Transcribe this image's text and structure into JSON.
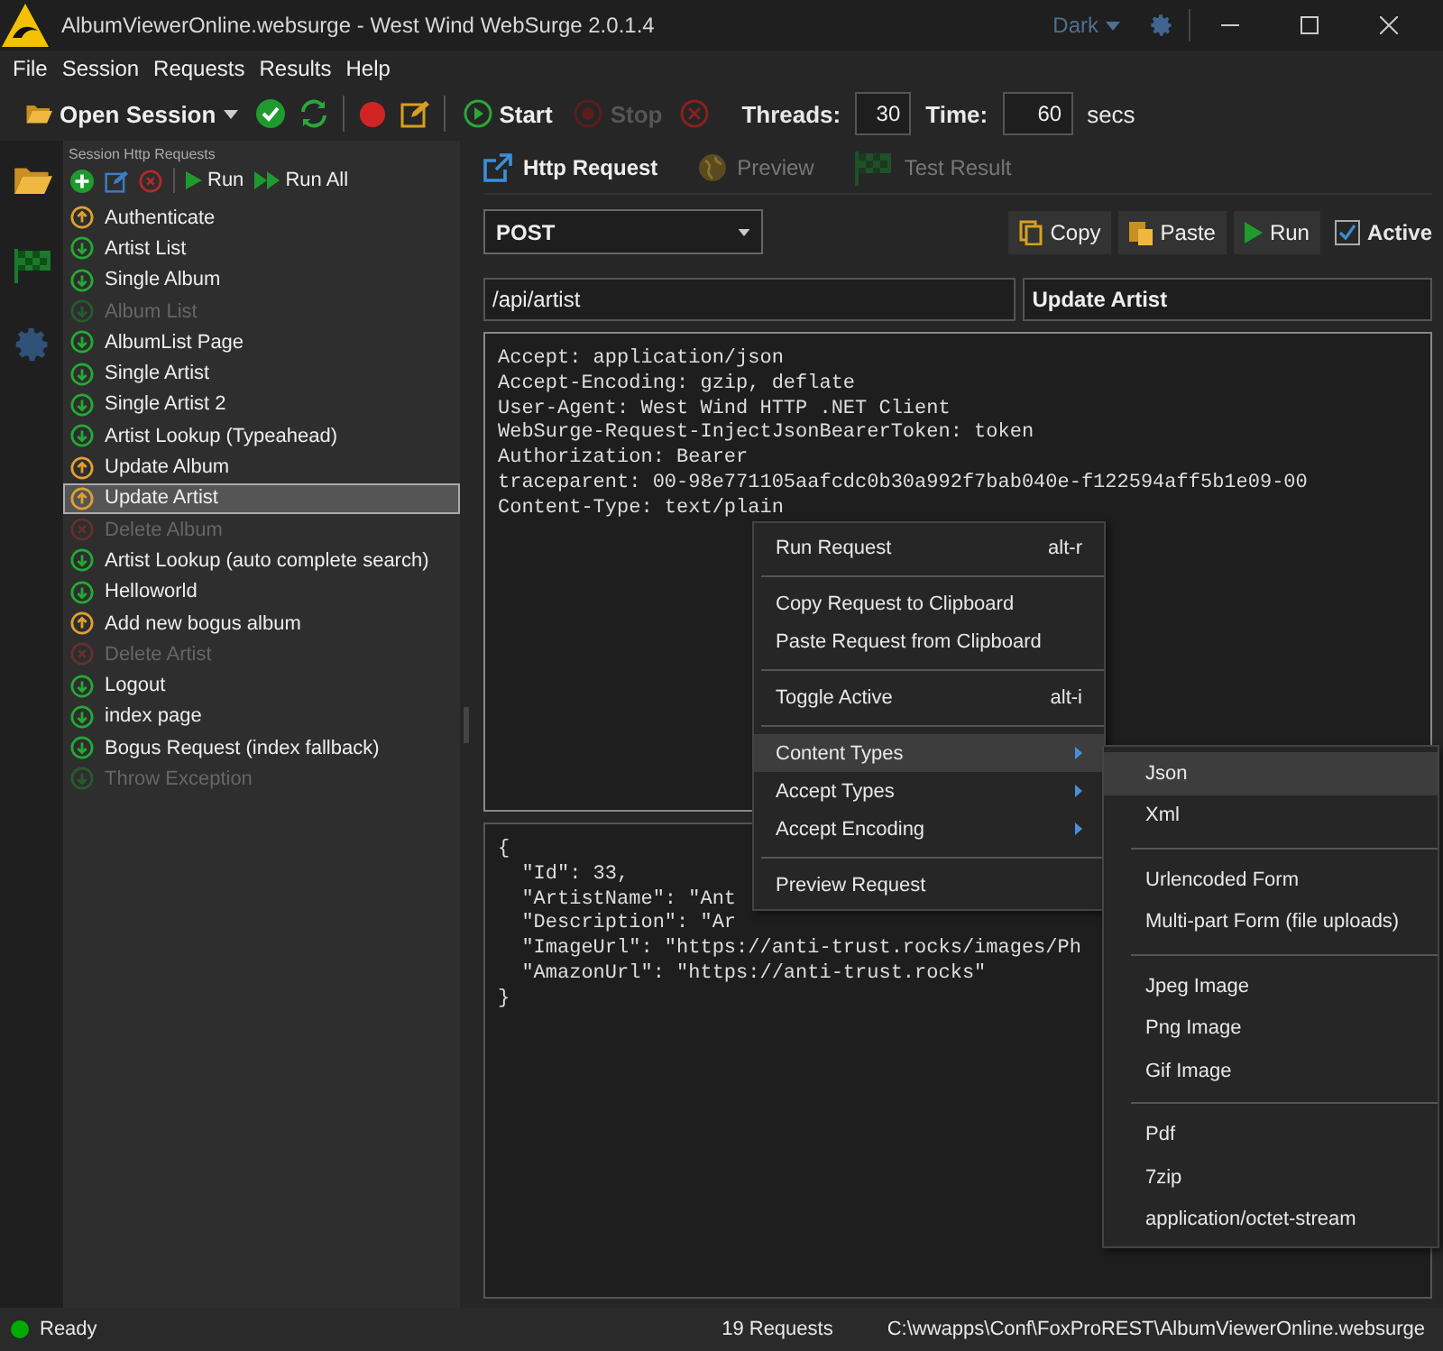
{
  "window": {
    "title": "AlbumViewerOnline.websurge - West Wind WebSurge 2.0.1.4",
    "theme": "Dark"
  },
  "menu_bar": [
    "File",
    "Session",
    "Requests",
    "Results",
    "Help"
  ],
  "toolbar": {
    "open_session": "Open Session",
    "start": "Start",
    "stop": "Stop",
    "threads_label": "Threads:",
    "threads": "30",
    "time_label": "Time:",
    "time": "60",
    "time_unit": "secs"
  },
  "requests_panel": {
    "title": "Session Http Requests",
    "run": "Run",
    "run_all": "Run All",
    "items": [
      {
        "name": "Authenticate",
        "kind": "put",
        "active": true,
        "selected": false
      },
      {
        "name": "Artist List",
        "kind": "get",
        "active": true,
        "selected": false
      },
      {
        "name": "Single Album",
        "kind": "get",
        "active": true,
        "selected": false
      },
      {
        "name": "Album List",
        "kind": "get",
        "active": false,
        "selected": false
      },
      {
        "name": "AlbumList Page",
        "kind": "get",
        "active": true,
        "selected": false
      },
      {
        "name": "Single Artist",
        "kind": "get",
        "active": true,
        "selected": false
      },
      {
        "name": "Single Artist 2",
        "kind": "get",
        "active": true,
        "selected": false
      },
      {
        "name": "Artist Lookup (Typeahead)",
        "kind": "get",
        "active": true,
        "selected": false
      },
      {
        "name": "Update Album",
        "kind": "put",
        "active": true,
        "selected": false
      },
      {
        "name": "Update Artist",
        "kind": "put",
        "active": true,
        "selected": true
      },
      {
        "name": "Delete Album",
        "kind": "delete",
        "active": false,
        "selected": false
      },
      {
        "name": "Artist Lookup (auto complete search)",
        "kind": "get",
        "active": true,
        "selected": false
      },
      {
        "name": "Helloworld",
        "kind": "get",
        "active": true,
        "selected": false
      },
      {
        "name": "Add new bogus album",
        "kind": "put",
        "active": true,
        "selected": false
      },
      {
        "name": "Delete Artist",
        "kind": "delete",
        "active": false,
        "selected": false
      },
      {
        "name": "Logout",
        "kind": "get",
        "active": true,
        "selected": false
      },
      {
        "name": "index page",
        "kind": "get",
        "active": true,
        "selected": false
      },
      {
        "name": "Bogus Request (index fallback)",
        "kind": "get",
        "active": true,
        "selected": false
      },
      {
        "name": "Throw Exception",
        "kind": "get",
        "active": false,
        "selected": false
      }
    ]
  },
  "tabs": [
    {
      "label": "Http Request",
      "selected": true
    },
    {
      "label": "Preview",
      "selected": false
    },
    {
      "label": "Test Result",
      "selected": false
    }
  ],
  "request": {
    "method": "POST",
    "copy": "Copy",
    "paste": "Paste",
    "run": "Run",
    "active": {
      "label": "Active",
      "checked": true
    },
    "url": "/api/artist",
    "name": "Update Artist",
    "headers": [
      "Accept: application/json",
      "Accept-Encoding: gzip, deflate",
      "User-Agent: West Wind HTTP .NET Client",
      "WebSurge-Request-InjectJsonBearerToken: token",
      "Authorization: Bearer",
      "traceparent: 00-98e771105aafcdc0b30a992f7bab040e-f122594aff5b1e09-00",
      "Content-Type: text/plain"
    ],
    "body": [
      "{",
      "  \"Id\": 33,",
      "  \"ArtistName\": \"Ant",
      "  \"Description\": \"Ar",
      "  \"ImageUrl\": \"https://anti-trust.rocks/images/Ph",
      "  \"AmazonUrl\": \"https://anti-trust.rocks\"",
      "}"
    ]
  },
  "context_menu": {
    "items": [
      {
        "kind": "item",
        "label": "Run Request",
        "shortcut": "alt-r",
        "submenu": false,
        "selected": false
      },
      {
        "kind": "separator"
      },
      {
        "kind": "item",
        "label": "Copy Request to Clipboard",
        "submenu": false,
        "selected": false
      },
      {
        "kind": "item",
        "label": "Paste Request from Clipboard",
        "submenu": false,
        "selected": false
      },
      {
        "kind": "separator"
      },
      {
        "kind": "item",
        "label": "Toggle Active",
        "shortcut": "alt-i",
        "submenu": false,
        "selected": false
      },
      {
        "kind": "separator"
      },
      {
        "kind": "item",
        "label": "Content Types",
        "submenu": true,
        "selected": true
      },
      {
        "kind": "item",
        "label": "Accept Types",
        "submenu": true,
        "selected": false
      },
      {
        "kind": "item",
        "label": "Accept Encoding",
        "submenu": true,
        "selected": false
      },
      {
        "kind": "separator"
      },
      {
        "kind": "item",
        "label": "Preview Request",
        "submenu": false,
        "selected": false
      }
    ]
  },
  "submenu": {
    "items": [
      {
        "kind": "item",
        "label": "Json",
        "selected": true
      },
      {
        "kind": "item",
        "label": "Xml",
        "selected": false
      },
      {
        "kind": "separator"
      },
      {
        "kind": "item",
        "label": "Urlencoded Form",
        "selected": false
      },
      {
        "kind": "item",
        "label": "Multi-part Form (file uploads)",
        "selected": false
      },
      {
        "kind": "separator"
      },
      {
        "kind": "item",
        "label": "Jpeg Image",
        "selected": false
      },
      {
        "kind": "item",
        "label": "Png Image",
        "selected": false
      },
      {
        "kind": "item",
        "label": "Gif Image",
        "selected": false
      },
      {
        "kind": "separator"
      },
      {
        "kind": "item",
        "label": "Pdf",
        "selected": false
      },
      {
        "kind": "item",
        "label": "7zip",
        "selected": false
      },
      {
        "kind": "item",
        "label": "application/octet-stream",
        "selected": false
      }
    ]
  },
  "status_bar": {
    "status": "Ready",
    "count": "19 Requests",
    "file": "C:\\wwapps\\Conf\\FoxProREST\\AlbumViewerOnline.websurge"
  }
}
